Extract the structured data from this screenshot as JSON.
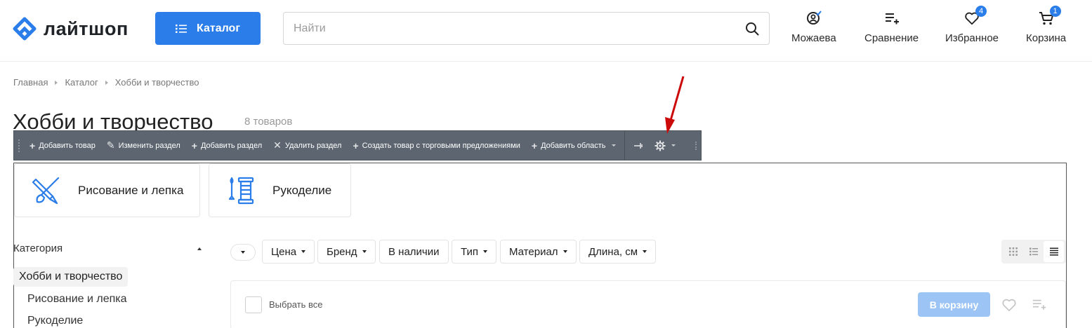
{
  "header": {
    "logo_text": "лайтшоп",
    "catalog_label": "Каталог",
    "search_placeholder": "Найти",
    "actions": [
      {
        "label": "Можаева",
        "icon": "user-icon",
        "badge": ""
      },
      {
        "label": "Сравнение",
        "icon": "compare-icon",
        "badge": ""
      },
      {
        "label": "Избранное",
        "icon": "heart-icon",
        "badge": "4"
      },
      {
        "label": "Корзина",
        "icon": "cart-icon",
        "badge": "1"
      }
    ]
  },
  "breadcrumb": [
    "Главная",
    "Каталог",
    "Хобби и творчество"
  ],
  "page": {
    "title": "Хобби и творчество",
    "count": "8 товаров"
  },
  "admin_toolbar": {
    "items": [
      {
        "label": "Добавить товар",
        "icon": "plus-icon"
      },
      {
        "label": "Изменить раздел",
        "icon": "pencil-icon"
      },
      {
        "label": "Добавить раздел",
        "icon": "plus-icon"
      },
      {
        "label": "Удалить раздел",
        "icon": "cross-icon"
      },
      {
        "label": "Создать товар с торговыми предложениями",
        "icon": "plus-icon"
      },
      {
        "label": "Добавить область",
        "icon": "plus-icon"
      }
    ]
  },
  "subsections": [
    {
      "label": "Рисование и лепка",
      "icon": "brush-pencil-icon"
    },
    {
      "label": "Рукоделие",
      "icon": "needle-thread-icon"
    }
  ],
  "sidebar": {
    "title": "Категория",
    "active": "Хобби и творчество",
    "items": [
      "Рисование и лепка",
      "Рукоделие"
    ]
  },
  "filters": [
    "Цена",
    "Бренд",
    "В наличии",
    "Тип",
    "Материал",
    "Длина, см"
  ],
  "list_header": {
    "select_all": "Выбрать все",
    "to_cart": "В корзину"
  },
  "colors": {
    "accent": "#2b7de9",
    "toolbar_bg": "#5d6670",
    "annotation": "#cc0a0a"
  }
}
